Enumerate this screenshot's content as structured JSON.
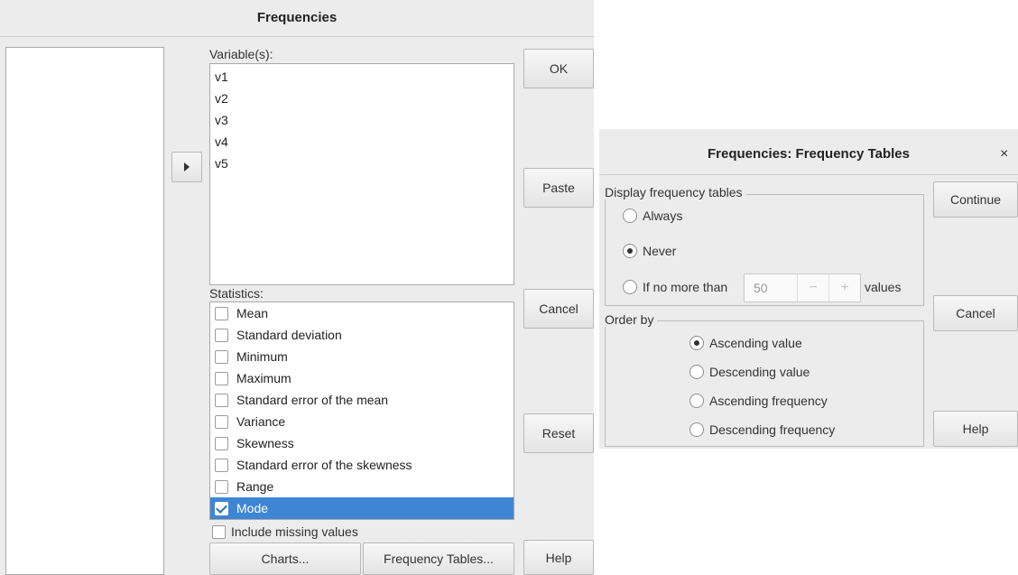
{
  "main_dialog": {
    "title": "Frequencies",
    "variables_label": "Variable(s):",
    "variables": [
      "v1",
      "v2",
      "v3",
      "v4",
      "v5"
    ],
    "statistics_label": "Statistics:",
    "statistics": [
      {
        "label": "Mean",
        "checked": false,
        "selected": false
      },
      {
        "label": "Standard deviation",
        "checked": false,
        "selected": false
      },
      {
        "label": "Minimum",
        "checked": false,
        "selected": false
      },
      {
        "label": "Maximum",
        "checked": false,
        "selected": false
      },
      {
        "label": "Standard error of the mean",
        "checked": false,
        "selected": false
      },
      {
        "label": "Variance",
        "checked": false,
        "selected": false
      },
      {
        "label": "Skewness",
        "checked": false,
        "selected": false
      },
      {
        "label": "Standard error of the skewness",
        "checked": false,
        "selected": false
      },
      {
        "label": "Range",
        "checked": false,
        "selected": false
      },
      {
        "label": "Mode",
        "checked": true,
        "selected": true
      }
    ],
    "include_missing_label": "Include missing values",
    "include_missing_checked": false,
    "buttons": {
      "ok": "OK",
      "paste": "Paste",
      "cancel": "Cancel",
      "reset": "Reset",
      "help": "Help",
      "charts": "Charts...",
      "frequency_tables": "Frequency Tables..."
    },
    "selection_color": "#3d86d6"
  },
  "freq_dialog": {
    "title": "Frequencies: Frequency Tables",
    "close_glyph": "×",
    "display_group": "Display frequency tables",
    "display_options": [
      {
        "label": "Always",
        "selected": false
      },
      {
        "label": "Never",
        "selected": true
      },
      {
        "label": "If no more than",
        "selected": false
      }
    ],
    "limit_value": "50",
    "limit_minus": "−",
    "limit_plus": "+",
    "limit_suffix": "values",
    "order_group": "Order by",
    "order_options": [
      {
        "label": "Ascending value",
        "selected": true
      },
      {
        "label": "Descending value",
        "selected": false
      },
      {
        "label": "Ascending frequency",
        "selected": false
      },
      {
        "label": "Descending frequency",
        "selected": false
      }
    ],
    "buttons": {
      "continue": "Continue",
      "cancel": "Cancel",
      "help": "Help"
    }
  }
}
